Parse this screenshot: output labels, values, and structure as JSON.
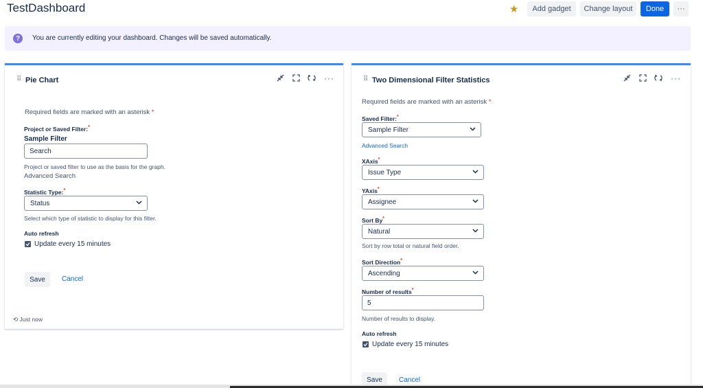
{
  "header": {
    "title": "TestDashboard",
    "add_gadget": "Add gadget",
    "change_layout": "Change layout",
    "done": "Done",
    "more": "···"
  },
  "banner": {
    "icon": "?",
    "message": "You are currently editing your dashboard. Changes will be saved automatically."
  },
  "pie": {
    "title": "Pie Chart",
    "required_note": "Required fields are marked with an asterisk",
    "project_label": "Project or Saved Filter:",
    "selected_filter": "Sample Filter",
    "search_value": "Search",
    "project_help": "Project or saved filter to use as the basis for the graph.",
    "advanced_search": "Advanced Search",
    "stat_label": "Statistic Type:",
    "stat_value": "Status",
    "stat_help": "Select which type of statistic to display for this filter.",
    "auto_refresh_label": "Auto refresh",
    "update_text": "Update every 15 minutes",
    "save": "Save",
    "cancel": "Cancel",
    "updated": "Just now"
  },
  "two_d": {
    "title": "Two Dimensional Filter Statistics",
    "required_note": "Required fields are marked with an asterisk",
    "saved_filter_label": "Saved Filter:",
    "saved_filter_value": "Sample Filter",
    "advanced_search": "Advanced Search",
    "xaxis_label": "XAxis",
    "xaxis_value": "Issue Type",
    "yaxis_label": "YAxis",
    "yaxis_value": "Assignee",
    "sortby_label": "Sort By",
    "sortby_value": "Natural",
    "sortby_help": "Sort by row total or natural field order.",
    "sortdir_label": "Sort Direction",
    "sortdir_value": "Ascending",
    "numres_label": "Number of results",
    "numres_value": "5",
    "numres_help": "Number of results to display.",
    "auto_refresh_label": "Auto refresh",
    "update_text": "Update every 15 minutes",
    "save": "Save",
    "cancel": "Cancel"
  },
  "colors": {
    "primary": "#0c66e4",
    "panel_accent": "#388bff",
    "banner_bg": "#f3f0ff",
    "required": "#de350b"
  }
}
